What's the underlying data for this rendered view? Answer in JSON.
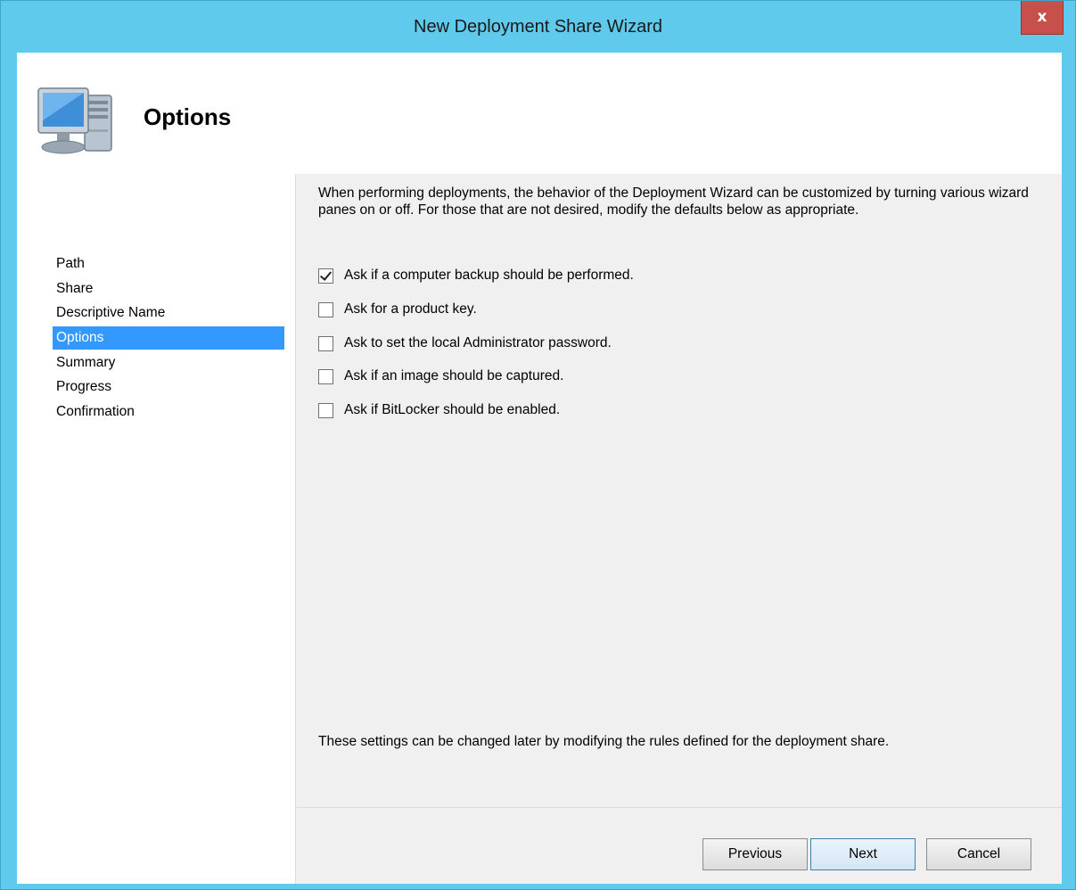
{
  "window": {
    "title": "New Deployment Share Wizard",
    "close_label": "x"
  },
  "header": {
    "icon": "computer-icon",
    "title": "Options"
  },
  "nav": {
    "items": [
      {
        "label": "Path",
        "active": false
      },
      {
        "label": "Share",
        "active": false
      },
      {
        "label": "Descriptive Name",
        "active": false
      },
      {
        "label": "Options",
        "active": true
      },
      {
        "label": "Summary",
        "active": false
      },
      {
        "label": "Progress",
        "active": false
      },
      {
        "label": "Confirmation",
        "active": false
      }
    ]
  },
  "content": {
    "intro": "When performing deployments, the behavior of the Deployment Wizard can be customized by turning various wizard panes on or off.  For those that are not desired, modify the defaults below as appropriate.",
    "options": [
      {
        "label": "Ask if a computer backup should be performed.",
        "checked": true
      },
      {
        "label": "Ask for a product key.",
        "checked": false
      },
      {
        "label": "Ask to set the local Administrator password.",
        "checked": false
      },
      {
        "label": "Ask if an image should be captured.",
        "checked": false
      },
      {
        "label": "Ask if BitLocker should be enabled.",
        "checked": false
      }
    ],
    "footnote": "These settings can be changed later by modifying the rules defined for the deployment share."
  },
  "buttons": {
    "previous": "Previous",
    "next": "Next",
    "cancel": "Cancel"
  },
  "colors": {
    "frame": "#5fcaec",
    "selection": "#3399ff",
    "close": "#c7504a"
  }
}
